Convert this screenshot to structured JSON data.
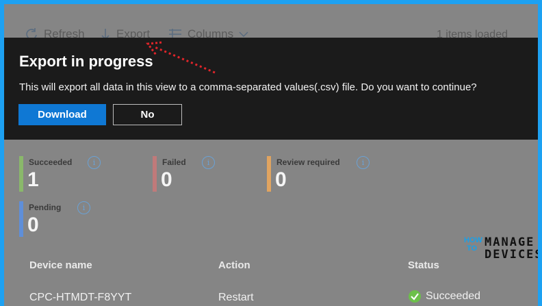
{
  "toolbar": {
    "refresh_label": "Refresh",
    "export_label": "Export",
    "columns_label": "Columns",
    "items_loaded": "1 items loaded"
  },
  "dialog": {
    "title": "Export in progress",
    "message": "This will export all data in this view to a comma-separated values(.csv) file. Do you want to continue?",
    "download_label": "Download",
    "no_label": "No"
  },
  "summary": [
    {
      "label": "Succeeded",
      "count": "1",
      "color": "#8ab86b"
    },
    {
      "label": "Failed",
      "count": "0",
      "color": "#c07a7a"
    },
    {
      "label": "Review required",
      "count": "0",
      "color": "#e0a460"
    },
    {
      "label": "Pending",
      "count": "0",
      "color": "#5f8fd9"
    }
  ],
  "info_icon": "i",
  "table": {
    "headers": [
      "Device name",
      "Action",
      "Status"
    ],
    "rows": [
      {
        "device": "CPC-HTMDT-F8YYT",
        "action": "Restart",
        "status": "Succeeded"
      }
    ]
  },
  "watermark": {
    "how": "HOW",
    "to": "TO",
    "manage": "MANAGE",
    "devices": "DEVICES"
  },
  "colors": {
    "accent": "#0f78d4",
    "arrow": "#e0252a",
    "success": "#6cc04a"
  }
}
